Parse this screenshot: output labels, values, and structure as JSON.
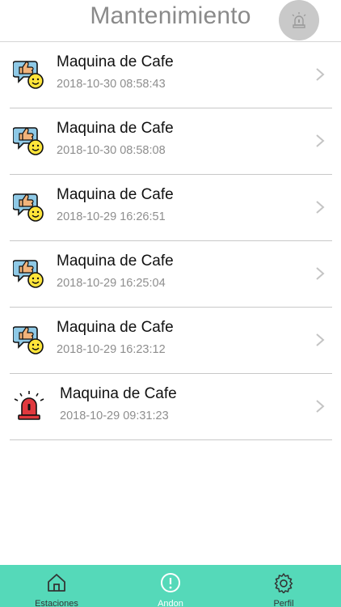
{
  "header": {
    "title": "Mantenimiento",
    "action_icon": "alarm-light-icon"
  },
  "items": [
    {
      "title": "Maquina de Cafe",
      "date": "2018-10-30 08:58:43",
      "icon": "feedback-thumbs-up-smiley-icon"
    },
    {
      "title": "Maquina de Cafe",
      "date": "2018-10-30 08:58:08",
      "icon": "feedback-thumbs-up-smiley-icon"
    },
    {
      "title": "Maquina de Cafe",
      "date": "2018-10-29 16:26:51",
      "icon": "feedback-thumbs-up-smiley-icon"
    },
    {
      "title": "Maquina de Cafe",
      "date": "2018-10-29 16:25:04",
      "icon": "feedback-thumbs-up-smiley-icon"
    },
    {
      "title": "Maquina de Cafe",
      "date": "2018-10-29 16:23:12",
      "icon": "feedback-thumbs-up-smiley-icon"
    },
    {
      "title": "Maquina de Cafe",
      "date": "2018-10-29 09:31:23",
      "icon": "alarm-siren-icon"
    }
  ],
  "tabbar": {
    "tabs": [
      {
        "label": "Estaciones",
        "icon": "home-icon",
        "active": false
      },
      {
        "label": "Andon",
        "icon": "alert-circle-icon",
        "active": true
      },
      {
        "label": "Perfil",
        "icon": "gear-icon",
        "active": false
      }
    ],
    "background": "#55d9b9"
  },
  "colors": {
    "header_title": "#8a8a8a",
    "alarm_button_bg": "#c9c9c9",
    "siren_red": "#e0393e",
    "smiley_yellow": "#ffe53a",
    "bubble_blue": "#8ec9e6"
  }
}
